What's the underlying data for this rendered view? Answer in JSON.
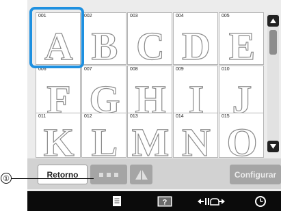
{
  "grid": {
    "tiles": [
      {
        "num": "001",
        "letter": "A"
      },
      {
        "num": "002",
        "letter": "B"
      },
      {
        "num": "003",
        "letter": "C"
      },
      {
        "num": "004",
        "letter": "D"
      },
      {
        "num": "005",
        "letter": "E"
      },
      {
        "num": "006",
        "letter": "F"
      },
      {
        "num": "007",
        "letter": "G"
      },
      {
        "num": "008",
        "letter": "H"
      },
      {
        "num": "009",
        "letter": "I"
      },
      {
        "num": "010",
        "letter": "J"
      },
      {
        "num": "011",
        "letter": "K"
      },
      {
        "num": "012",
        "letter": "L"
      },
      {
        "num": "013",
        "letter": "M"
      },
      {
        "num": "014",
        "letter": "N"
      },
      {
        "num": "015",
        "letter": "O"
      }
    ],
    "selected_num": "001"
  },
  "scrollbar": {
    "up_icon": "triangle-up-icon",
    "down_icon": "triangle-down-icon",
    "position_fraction": 0.0
  },
  "toolbar": {
    "retorno_label": "Retorno",
    "dots_icon": "three-dots-icon",
    "mirror_icon": "mirror-icon",
    "configurar_label": "Configurar"
  },
  "bottom_bar": {
    "icons": [
      "page-icon",
      "help-icon",
      "presser-foot-icon",
      "clock-icon"
    ]
  },
  "callout": {
    "number": "①"
  },
  "colors": {
    "selection": "#1e90e0",
    "panel": "#ececec",
    "toolbar": "#d2d2d2",
    "bottom_bar": "#0b0b0b"
  }
}
